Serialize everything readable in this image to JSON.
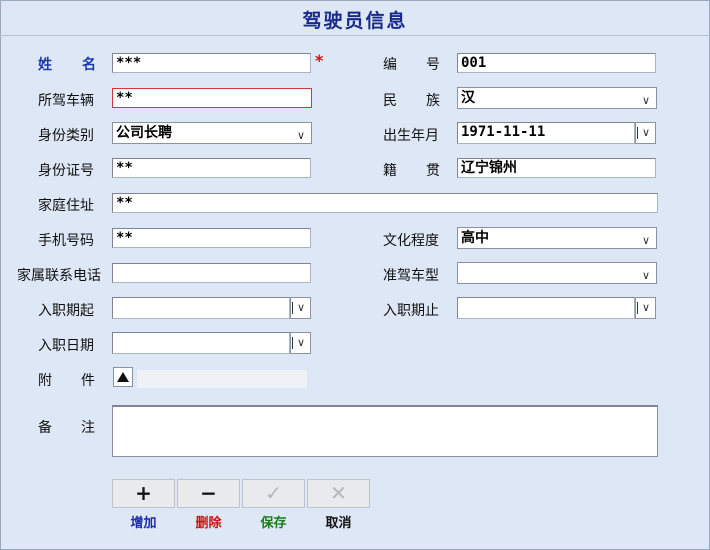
{
  "title": "驾驶员信息",
  "required_mark": "*",
  "fields": {
    "name": {
      "label": "姓名",
      "value": "***"
    },
    "number": {
      "label": "编号",
      "value": "001"
    },
    "vehicle": {
      "label": "所驾车辆",
      "value": "**"
    },
    "ethnicity": {
      "label": "民族",
      "value": "汉"
    },
    "id_type": {
      "label": "身份类别",
      "value": "公司长聘"
    },
    "birth": {
      "label": "出生年月",
      "value": "1971-11-11"
    },
    "id_number": {
      "label": "身份证号",
      "value": "**"
    },
    "native_place": {
      "label": "籍贯",
      "value": "辽宁锦州"
    },
    "address": {
      "label": "家庭住址",
      "value": "**"
    },
    "phone": {
      "label": "手机号码",
      "value": "**"
    },
    "education": {
      "label": "文化程度",
      "value": "高中"
    },
    "family_phone": {
      "label": "家属联系电话",
      "value": ""
    },
    "license_type": {
      "label": "准驾车型",
      "value": ""
    },
    "hire_start": {
      "label": "入职期起",
      "value": ""
    },
    "hire_end": {
      "label": "入职期止",
      "value": ""
    },
    "hire_date": {
      "label": "入职日期",
      "value": ""
    },
    "attachment": {
      "label": "附件"
    },
    "remarks": {
      "label": "备注",
      "value": ""
    }
  },
  "icons": {
    "dropdown": "chevron-down-icon",
    "upload": "upload-arrow-icon"
  },
  "toolbar": {
    "add": {
      "icon": "+",
      "label": "增加",
      "color": "#1a2bb0"
    },
    "delete": {
      "icon": "−",
      "label": "删除",
      "color": "#d01010"
    },
    "save": {
      "icon": "✓",
      "label": "保存",
      "color": "#1a7a1a"
    },
    "cancel": {
      "icon": "✕",
      "label": "取消",
      "color": "#111111"
    }
  }
}
